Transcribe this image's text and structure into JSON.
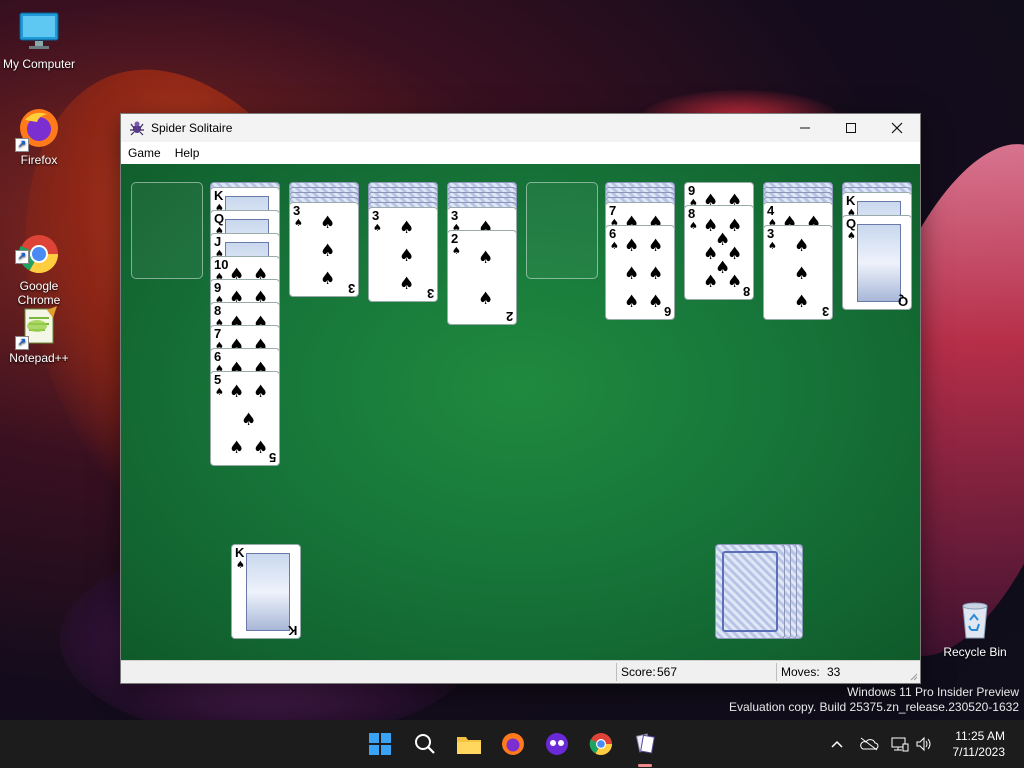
{
  "desktop": {
    "icons": [
      {
        "label": "My Computer"
      },
      {
        "label": "Firefox"
      },
      {
        "label": "Google\nChrome"
      },
      {
        "label": "Notepad++"
      },
      {
        "label": "Recycle Bin"
      }
    ]
  },
  "window": {
    "title": "Spider Solitaire",
    "menu": [
      "Game",
      "Help"
    ],
    "status": {
      "score_label": "Score:",
      "score": "567",
      "moves_label": "Moves:",
      "moves": "33"
    }
  },
  "board": {
    "suit": "♠",
    "columns": [
      {
        "backs": 0,
        "cards": []
      },
      {
        "backs": 1,
        "cards": [
          "K",
          "Q",
          "J",
          "10",
          "9",
          "8",
          "7",
          "6",
          "5"
        ]
      },
      {
        "backs": 4,
        "cards": [
          "3"
        ]
      },
      {
        "backs": 5,
        "cards": [
          "3"
        ]
      },
      {
        "backs": 5,
        "cards": [
          "3",
          "2"
        ]
      },
      {
        "backs": 0,
        "cards": []
      },
      {
        "backs": 4,
        "cards": [
          "7",
          "6"
        ]
      },
      {
        "backs": 0,
        "cards": [
          "9",
          "8"
        ]
      },
      {
        "backs": 4,
        "cards": [
          "4",
          "3"
        ]
      },
      {
        "backs": 2,
        "cards": [
          "K",
          "Q"
        ]
      }
    ],
    "foundation": [
      "K"
    ],
    "stock_piles": 4
  },
  "taskbar": {
    "time": "11:25 AM",
    "date": "7/11/2023"
  },
  "watermark": {
    "line1": "Windows 11 Pro Insider Preview",
    "line2": "Evaluation copy. Build 25375.zn_release.230520-1632"
  }
}
